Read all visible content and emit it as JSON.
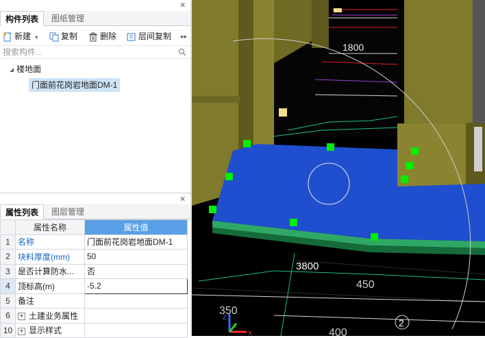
{
  "component_pane": {
    "tabs": [
      "构件列表",
      "图纸管理"
    ],
    "toolbar": {
      "new_label": "新建",
      "copy_label": "复制",
      "delete_label": "删除",
      "floor_copy_label": "层间复制"
    },
    "search_placeholder": "搜索构件...",
    "tree": {
      "root_label": "楼地面",
      "child_label": "门面前花岗岩地面DM-1"
    }
  },
  "property_pane": {
    "tabs": [
      "属性列表",
      "图层管理"
    ],
    "headers": {
      "name": "属性名称",
      "value": "属性值"
    },
    "rows": [
      {
        "num": "1",
        "name": "名称",
        "value": "门面前花岗岩地面DM-1"
      },
      {
        "num": "2",
        "name": "块料厚度(mm)",
        "value": "50"
      },
      {
        "num": "3",
        "name": "是否计算防水...",
        "value": "否"
      },
      {
        "num": "4",
        "name": "顶标高(m)",
        "value": "-5.2"
      },
      {
        "num": "5",
        "name": "备注",
        "value": ""
      },
      {
        "num": "6",
        "name": "土建业务属性",
        "value": ""
      },
      {
        "num": "10",
        "name": "显示样式",
        "value": ""
      }
    ]
  },
  "viewport": {
    "dimension_labels": [
      "1800",
      "3800",
      "450",
      "350",
      "400",
      "2"
    ],
    "axis_labels": [
      "Z",
      "Y",
      "X"
    ],
    "colors": {
      "background": "#000000",
      "wall": "#7f7a2c",
      "slab": "#1f4fcf",
      "slab_edge": "#2fa866",
      "grip": "#00ee00"
    }
  }
}
